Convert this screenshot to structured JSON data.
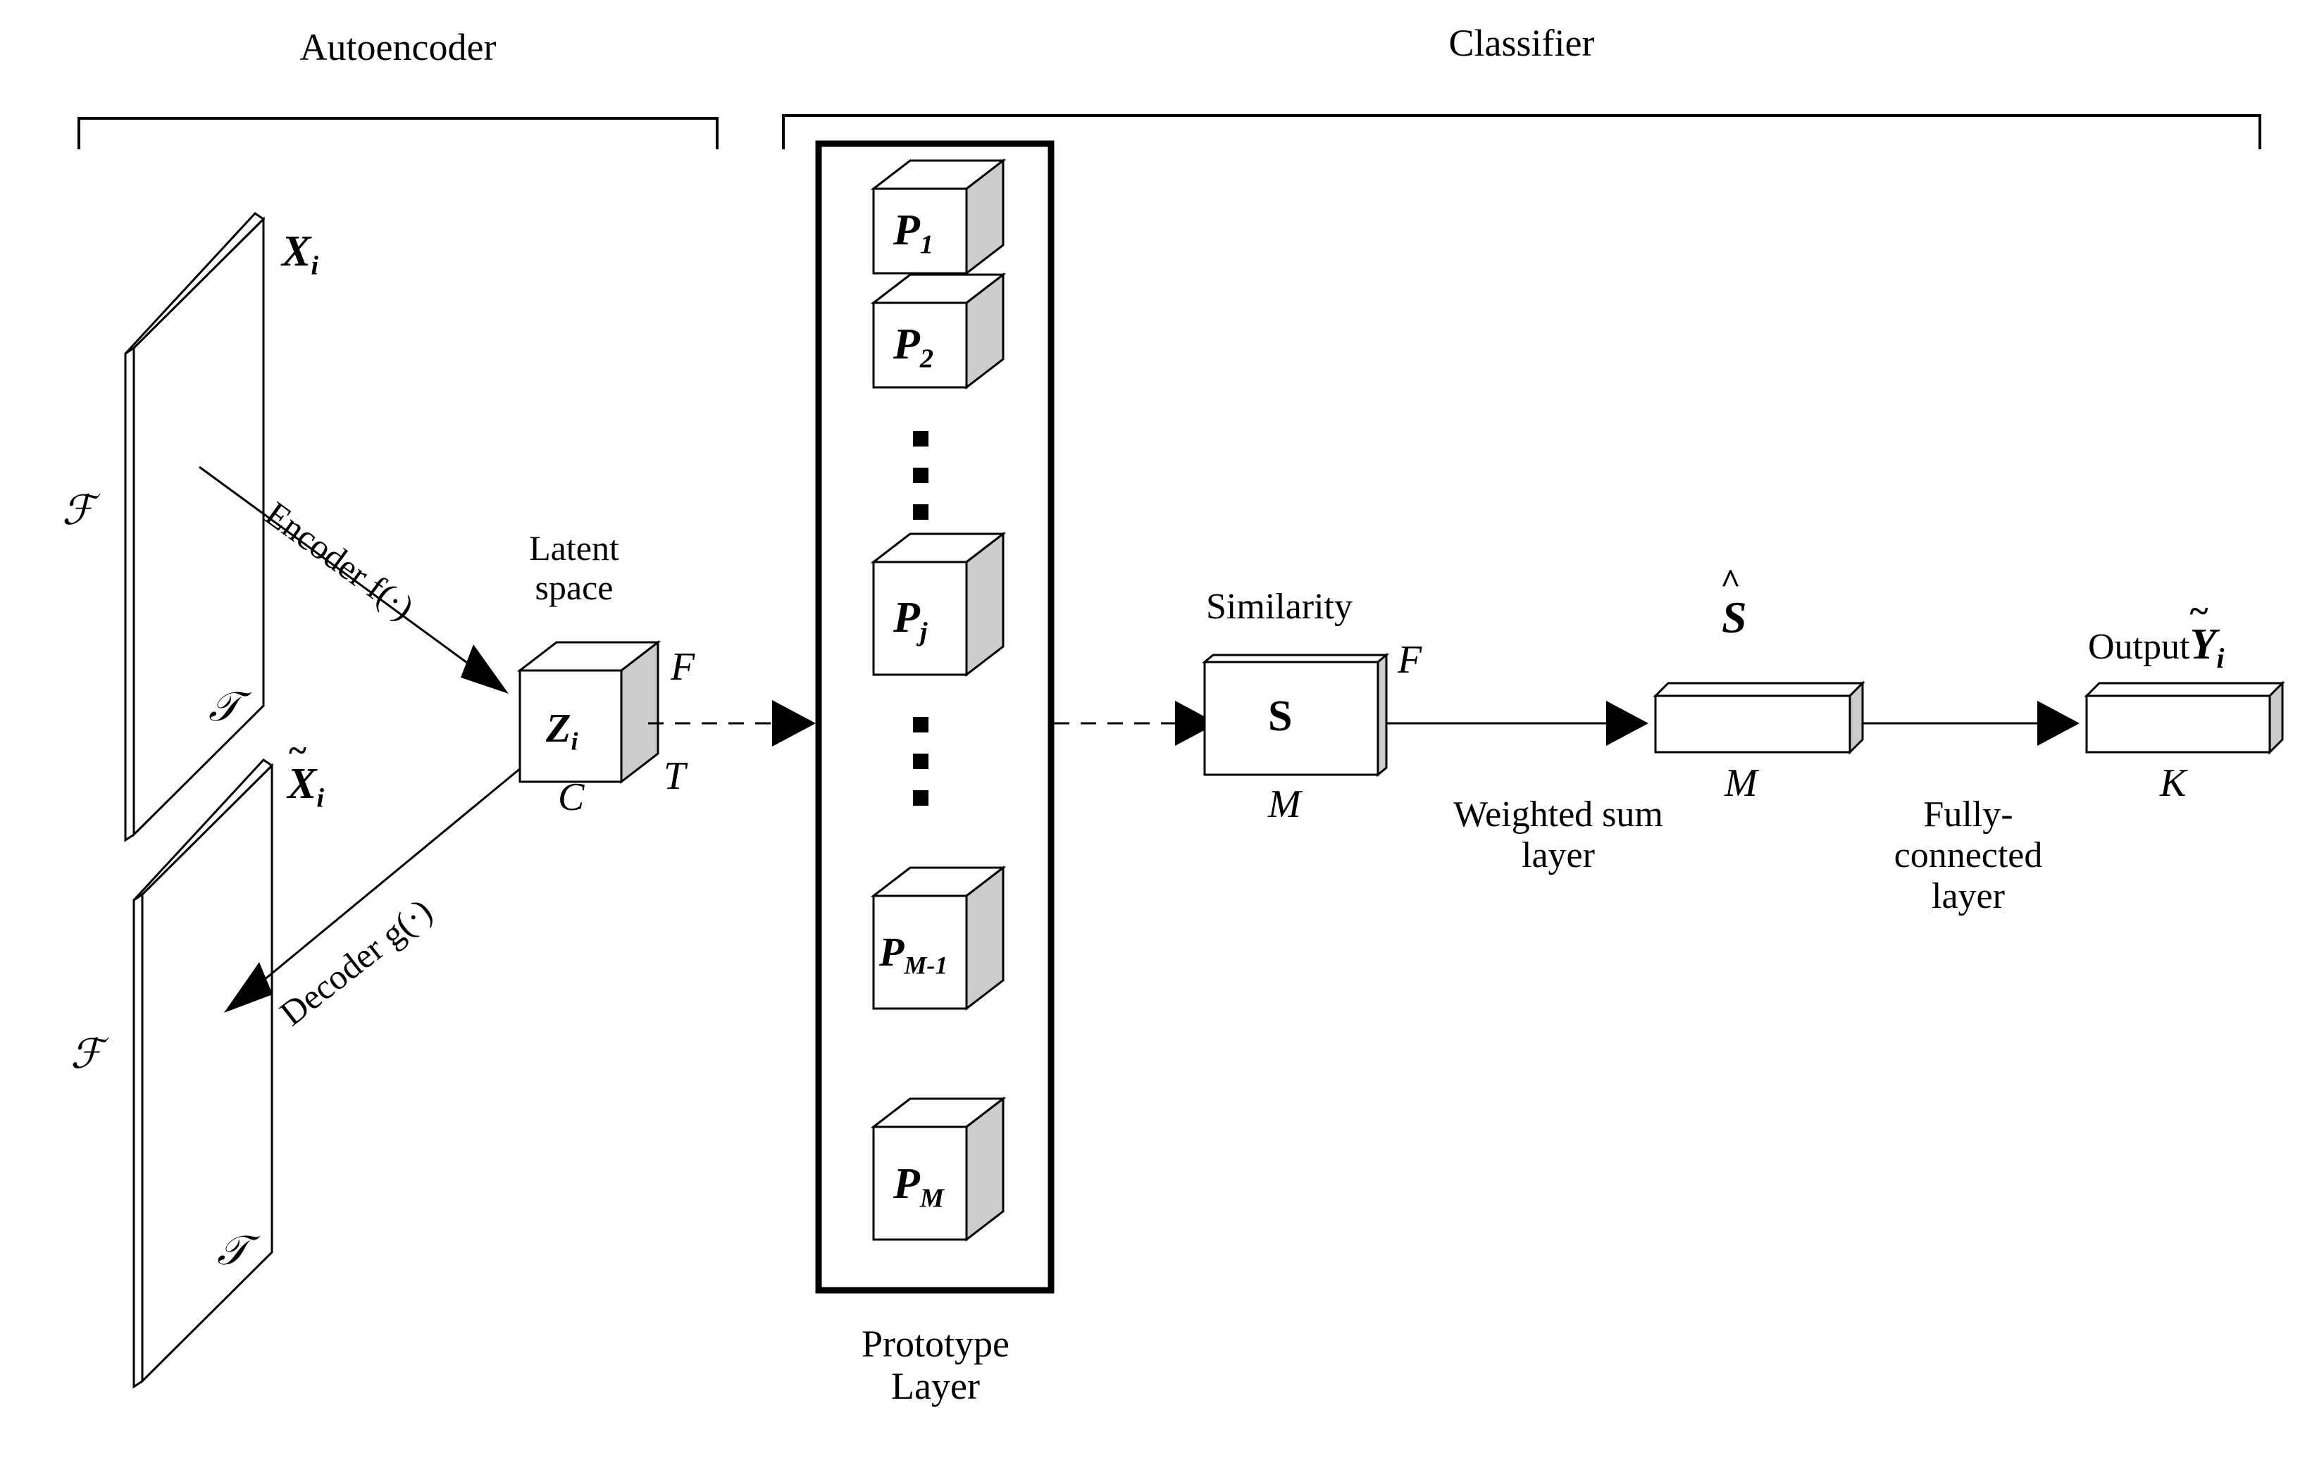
{
  "title": "Prototype-based autoencoder classifier architecture",
  "sections": {
    "autoencoder": {
      "label": "Autoencoder"
    },
    "classifier": {
      "label": "Classifier"
    }
  },
  "autoencoder": {
    "input_plate": {
      "name": "X_i",
      "label_main": "X",
      "label_sub": "i",
      "axis_vertical": "ℱ",
      "axis_horizontal": "𝒯"
    },
    "output_plate": {
      "name": "Xtilde_i",
      "label_main": "X",
      "label_tilde": "~",
      "label_sub": "i",
      "axis_vertical": "ℱ",
      "axis_horizontal": "𝒯"
    },
    "encoder_arrow": {
      "label": "Encoder f(·)"
    },
    "decoder_arrow": {
      "label": "Decoder g(·)"
    },
    "latent": {
      "caption_line1": "Latent",
      "caption_line2": "space",
      "cube_label_main": "Z",
      "cube_label_sub": "i",
      "dim_right_top": "F",
      "dim_right_bottom": "T",
      "dim_bottom": "C"
    }
  },
  "prototype_layer": {
    "caption_line1": "Prototype",
    "caption_line2": "Layer",
    "prototypes": [
      {
        "main": "P",
        "sub": "1"
      },
      {
        "main": "P",
        "sub": "2"
      },
      {
        "main": "P",
        "sub": "j"
      },
      {
        "main": "P",
        "sub": "M-1"
      },
      {
        "main": "P",
        "sub": "M"
      }
    ],
    "ellipsis_glyph": "▪"
  },
  "classifier": {
    "similarity": {
      "caption": "Similarity",
      "box_label": "S",
      "dim_right": "F",
      "dim_bottom": "M"
    },
    "weighted_sum": {
      "caption_line1": "Weighted sum",
      "caption_line2": "layer"
    },
    "shat": {
      "label_hat": "^",
      "label_main": "S",
      "dim_bottom": "M"
    },
    "fully_connected": {
      "caption_line1": "Fully-",
      "caption_line2": "connected",
      "caption_line3": "layer"
    },
    "output": {
      "caption": "Output",
      "label_tilde": "~",
      "label_main": "Y",
      "label_sub": "i",
      "dim_bottom": "K"
    }
  },
  "colors": {
    "stroke": "#000000",
    "cube_side_fill": "#cccccc",
    "cube_face_fill": "#ffffff",
    "background": "#ffffff"
  }
}
